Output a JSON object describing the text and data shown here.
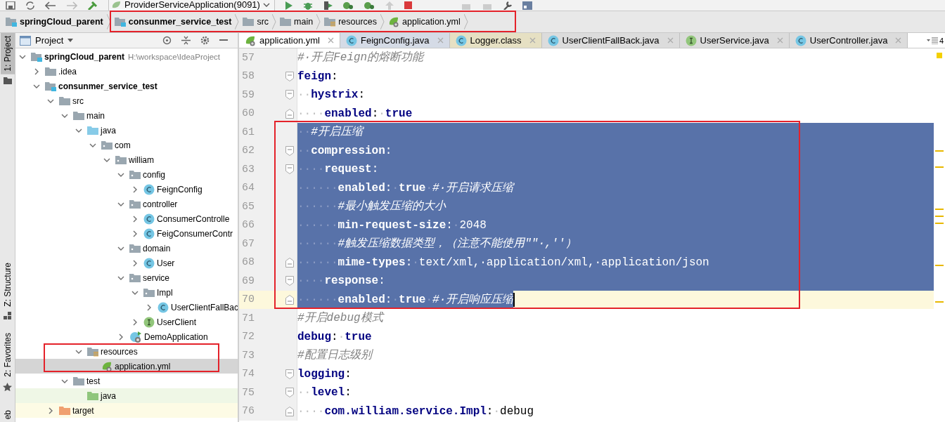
{
  "toolbar": {
    "run_config": "ProviderServiceApplication(9091)"
  },
  "breadcrumb": [
    {
      "label": "springCloud_parent",
      "kind": "module"
    },
    {
      "label": "consunmer_service_test",
      "kind": "module"
    },
    {
      "label": "src",
      "kind": "folder"
    },
    {
      "label": "main",
      "kind": "folder"
    },
    {
      "label": "resources",
      "kind": "resources"
    },
    {
      "label": "application.yml",
      "kind": "yml"
    }
  ],
  "tool_stripe": [
    {
      "label": "1: Project",
      "selected": true
    },
    {
      "label": "Z: Structure",
      "selected": false
    },
    {
      "label": "2: Favorites",
      "selected": false
    },
    {
      "label": "eb",
      "selected": false
    }
  ],
  "project_panel": {
    "title": "Project",
    "tree": [
      {
        "label": "springCloud_parent",
        "kind": "module",
        "path": "H:\\workspace\\IdeaProject",
        "expanded": true,
        "selected": false,
        "children": [
          {
            "label": ".idea",
            "kind": "folder",
            "expanded": false,
            "selected": false
          },
          {
            "label": "consunmer_service_test",
            "kind": "module",
            "expanded": true,
            "selected": false,
            "children": [
              {
                "label": "src",
                "kind": "folder",
                "expanded": true,
                "selected": false,
                "children": [
                  {
                    "label": "main",
                    "kind": "folder",
                    "expanded": true,
                    "selected": false,
                    "children": [
                      {
                        "label": "java",
                        "kind": "source",
                        "expanded": true,
                        "selected": false,
                        "children": [
                          {
                            "label": "com",
                            "kind": "package",
                            "expanded": true,
                            "selected": false,
                            "children": [
                              {
                                "label": "william",
                                "kind": "package",
                                "expanded": true,
                                "selected": false,
                                "children": [
                                  {
                                    "label": "config",
                                    "kind": "package",
                                    "expanded": true,
                                    "selected": false,
                                    "children": [
                                      {
                                        "label": "FeignConfig",
                                        "kind": "class",
                                        "expanded": false,
                                        "selected": false
                                      }
                                    ]
                                  },
                                  {
                                    "label": "controller",
                                    "kind": "package",
                                    "expanded": true,
                                    "selected": false,
                                    "children": [
                                      {
                                        "label": "ConsumerControlle",
                                        "kind": "class",
                                        "expanded": false,
                                        "selected": false
                                      },
                                      {
                                        "label": "FeigConsumerContr",
                                        "kind": "class",
                                        "expanded": false,
                                        "selected": false
                                      }
                                    ]
                                  },
                                  {
                                    "label": "domain",
                                    "kind": "package",
                                    "expanded": true,
                                    "selected": false,
                                    "children": [
                                      {
                                        "label": "User",
                                        "kind": "class",
                                        "expanded": false,
                                        "selected": false
                                      }
                                    ]
                                  },
                                  {
                                    "label": "service",
                                    "kind": "package",
                                    "expanded": true,
                                    "selected": false,
                                    "children": [
                                      {
                                        "label": "Impl",
                                        "kind": "package",
                                        "expanded": true,
                                        "selected": false,
                                        "children": [
                                          {
                                            "label": "UserClientFallBac",
                                            "kind": "class",
                                            "expanded": false,
                                            "selected": false
                                          }
                                        ]
                                      },
                                      {
                                        "label": "UserClient",
                                        "kind": "interface",
                                        "expanded": false,
                                        "selected": false
                                      }
                                    ]
                                  },
                                  {
                                    "label": "DemoApplication",
                                    "kind": "spring",
                                    "expanded": false,
                                    "selected": false
                                  }
                                ]
                              }
                            ]
                          }
                        ]
                      },
                      {
                        "label": "resources",
                        "kind": "resources",
                        "expanded": true,
                        "selected": false,
                        "children": [
                          {
                            "label": "application.yml",
                            "kind": "yml",
                            "selected": true
                          }
                        ]
                      }
                    ]
                  },
                  {
                    "label": "test",
                    "kind": "folder",
                    "expanded": true,
                    "selected": false,
                    "children": [
                      {
                        "label": "java",
                        "kind": "test-source",
                        "selected": false
                      }
                    ]
                  }
                ]
              },
              {
                "label": "target",
                "kind": "excluded",
                "expanded": false,
                "selected": false
              }
            ]
          }
        ]
      }
    ]
  },
  "tabs": [
    {
      "label": "application.yml",
      "kind": "yml",
      "selected": true
    },
    {
      "label": "FeignConfig.java",
      "kind": "class",
      "selected": false,
      "color": "#d5dbe6"
    },
    {
      "label": "Logger.class",
      "kind": "class",
      "selected": false,
      "color": "#e6e0c3"
    },
    {
      "label": "UserClientFallBack.java",
      "kind": "class",
      "selected": false
    },
    {
      "label": "UserService.java",
      "kind": "interface",
      "selected": false
    },
    {
      "label": "UserController.java",
      "kind": "class",
      "selected": false
    }
  ],
  "tab_overflow_count": "4",
  "code_lines": [
    {
      "number": "57",
      "kind": "plain",
      "tokens": [
        {
          "kind": "comment",
          "text": "#·开启Feign的熔断功能"
        }
      ]
    },
    {
      "number": "58",
      "kind": "fold-start",
      "tokens": [
        {
          "kind": "key",
          "text": "feign"
        },
        {
          "kind": "punct",
          "text": ":"
        }
      ]
    },
    {
      "number": "59",
      "kind": "fold-start",
      "tokens": [
        {
          "kind": "ws",
          "text": "··"
        },
        {
          "kind": "key",
          "text": "hystrix"
        },
        {
          "kind": "punct",
          "text": ":"
        }
      ]
    },
    {
      "number": "60",
      "kind": "fold-end",
      "tokens": [
        {
          "kind": "ws",
          "text": "····"
        },
        {
          "kind": "key",
          "text": "enabled"
        },
        {
          "kind": "punct",
          "text": ":"
        },
        {
          "kind": "ws",
          "text": "·"
        },
        {
          "kind": "bool",
          "text": "true"
        }
      ]
    },
    {
      "number": "61",
      "kind": "plain",
      "selected": true,
      "tokens": [
        {
          "kind": "ws",
          "text": "··"
        },
        {
          "kind": "comment",
          "text": "#开启压缩"
        }
      ]
    },
    {
      "number": "62",
      "kind": "fold-start",
      "selected": true,
      "tokens": [
        {
          "kind": "ws",
          "text": "··"
        },
        {
          "kind": "key",
          "text": "compression"
        },
        {
          "kind": "punct",
          "text": ":"
        }
      ]
    },
    {
      "number": "63",
      "kind": "fold-start",
      "selected": true,
      "tokens": [
        {
          "kind": "ws",
          "text": "····"
        },
        {
          "kind": "key",
          "text": "request"
        },
        {
          "kind": "punct",
          "text": ":"
        }
      ]
    },
    {
      "number": "64",
      "kind": "plain",
      "selected": true,
      "tokens": [
        {
          "kind": "ws",
          "text": "······"
        },
        {
          "kind": "key",
          "text": "enabled"
        },
        {
          "kind": "punct",
          "text": ":"
        },
        {
          "kind": "ws",
          "text": "·"
        },
        {
          "kind": "bool",
          "text": "true"
        },
        {
          "kind": "ws",
          "text": "·"
        },
        {
          "kind": "comment",
          "text": "#·开启请求压缩"
        }
      ]
    },
    {
      "number": "65",
      "kind": "plain",
      "selected": true,
      "tokens": [
        {
          "kind": "ws",
          "text": "······"
        },
        {
          "kind": "comment",
          "text": "#最小触发压缩的大小"
        }
      ]
    },
    {
      "number": "66",
      "kind": "plain",
      "selected": true,
      "tokens": [
        {
          "kind": "ws",
          "text": "······"
        },
        {
          "kind": "key",
          "text": "min-request-size"
        },
        {
          "kind": "punct",
          "text": ":"
        },
        {
          "kind": "ws",
          "text": "·"
        },
        {
          "kind": "value",
          "text": "2048"
        }
      ]
    },
    {
      "number": "67",
      "kind": "plain",
      "selected": true,
      "tokens": [
        {
          "kind": "ws",
          "text": "······"
        },
        {
          "kind": "comment",
          "text": "#触发压缩数据类型，（注意不能使用\"\"·,''）"
        }
      ]
    },
    {
      "number": "68",
      "kind": "fold-end",
      "selected": true,
      "tokens": [
        {
          "kind": "ws",
          "text": "······"
        },
        {
          "kind": "key",
          "text": "mime-types"
        },
        {
          "kind": "punct",
          "text": ":"
        },
        {
          "kind": "ws",
          "text": "·"
        },
        {
          "kind": "value",
          "text": "text/xml,·application/xml,·application/json"
        }
      ]
    },
    {
      "number": "69",
      "kind": "fold-start",
      "selected": true,
      "tokens": [
        {
          "kind": "ws",
          "text": "····"
        },
        {
          "kind": "key",
          "text": "response"
        },
        {
          "kind": "punct",
          "text": ":"
        }
      ]
    },
    {
      "number": "70",
      "kind": "fold-end",
      "selected": true,
      "current": true,
      "tokens": [
        {
          "kind": "ws",
          "text": "······"
        },
        {
          "kind": "key",
          "text": "enabled"
        },
        {
          "kind": "punct",
          "text": ":"
        },
        {
          "kind": "ws",
          "text": "·"
        },
        {
          "kind": "bool",
          "text": "true"
        },
        {
          "kind": "ws",
          "text": "·"
        },
        {
          "kind": "comment",
          "text": "#·开启响应压缩"
        }
      ]
    },
    {
      "number": "71",
      "kind": "plain",
      "tokens": [
        {
          "kind": "comment",
          "text": "#开启debug模式"
        }
      ]
    },
    {
      "number": "72",
      "kind": "plain",
      "tokens": [
        {
          "kind": "key",
          "text": "debug"
        },
        {
          "kind": "punct",
          "text": ":"
        },
        {
          "kind": "ws",
          "text": "·"
        },
        {
          "kind": "bool",
          "text": "true"
        }
      ]
    },
    {
      "number": "73",
      "kind": "plain",
      "tokens": [
        {
          "kind": "comment",
          "text": "#配置日志级别"
        }
      ]
    },
    {
      "number": "74",
      "kind": "fold-start",
      "tokens": [
        {
          "kind": "key",
          "text": "logging"
        },
        {
          "kind": "punct",
          "text": ":"
        }
      ]
    },
    {
      "number": "75",
      "kind": "fold-start",
      "tokens": [
        {
          "kind": "ws",
          "text": "··"
        },
        {
          "kind": "key",
          "text": "level"
        },
        {
          "kind": "punct",
          "text": ":"
        }
      ]
    },
    {
      "number": "76",
      "kind": "fold-end",
      "tokens": [
        {
          "kind": "ws",
          "text": "····"
        },
        {
          "kind": "key",
          "text": "com.william.service.Impl"
        },
        {
          "kind": "punct",
          "text": ":"
        },
        {
          "kind": "ws",
          "text": "·"
        },
        {
          "kind": "value",
          "text": "debug"
        }
      ]
    }
  ]
}
